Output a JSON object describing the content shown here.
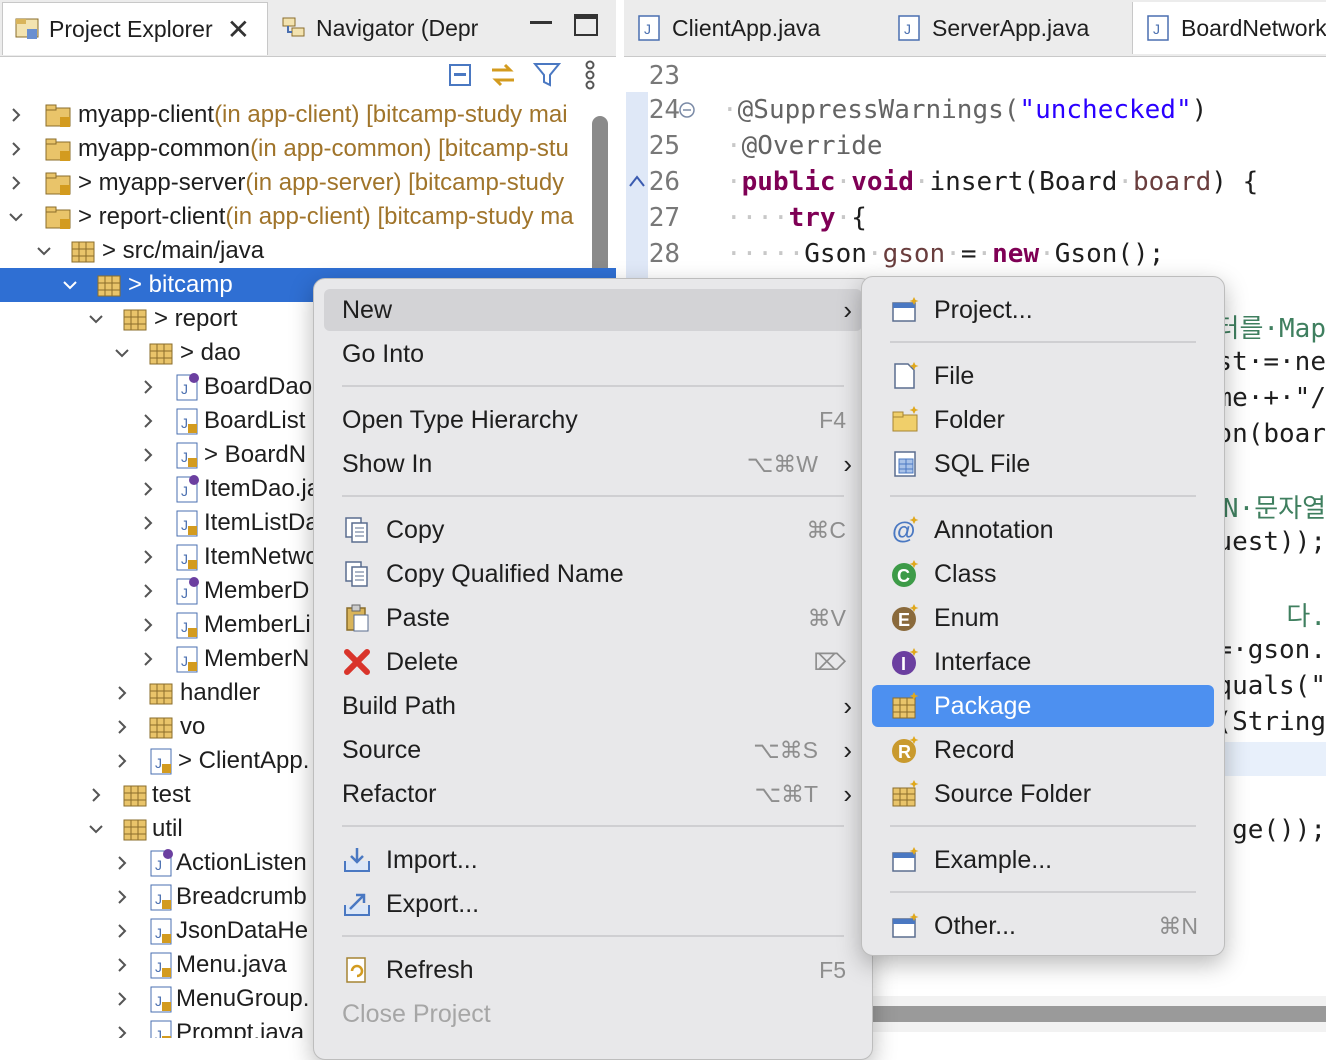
{
  "left_panel": {
    "tabs": [
      {
        "label": "Project Explorer",
        "icon": "project-explorer-icon",
        "active": true
      },
      {
        "label": "Navigator (Depr",
        "icon": "navigator-icon",
        "active": false
      }
    ],
    "toolbar_icons": [
      "collapse-all-icon",
      "link-with-editor-icon",
      "filter-icon",
      "view-menu-icon"
    ],
    "tree": [
      {
        "name": "myapp-client",
        "suffix": " (in app-client) [bitcamp-study mai"
      },
      {
        "name": "myapp-common",
        "suffix": " (in app-common) [bitcamp-stu"
      },
      {
        "name": "> myapp-server",
        "suffix": " (in app-server) [bitcamp-study"
      },
      {
        "name": "> report-client",
        "suffix": " (in app-client) [bitcamp-study ma"
      },
      {
        "name": "> src/main/java",
        "suffix": ""
      },
      {
        "name": "> bitcamp",
        "suffix": ""
      },
      {
        "name": "> report",
        "suffix": ""
      },
      {
        "name": "> dao",
        "suffix": ""
      },
      {
        "name": "BoardDao",
        "suffix": ""
      },
      {
        "name": "BoardList",
        "suffix": ""
      },
      {
        "name": "> BoardN",
        "suffix": ""
      },
      {
        "name": "ItemDao.ja",
        "suffix": ""
      },
      {
        "name": "ItemListDa",
        "suffix": ""
      },
      {
        "name": "ItemNetwo",
        "suffix": ""
      },
      {
        "name": "MemberD",
        "suffix": ""
      },
      {
        "name": "MemberLi",
        "suffix": ""
      },
      {
        "name": "MemberN",
        "suffix": ""
      },
      {
        "name": "handler",
        "suffix": ""
      },
      {
        "name": "vo",
        "suffix": ""
      },
      {
        "name": "> ClientApp.",
        "suffix": ""
      },
      {
        "name": "test",
        "suffix": ""
      },
      {
        "name": "util",
        "suffix": ""
      },
      {
        "name": "ActionListen",
        "suffix": ""
      },
      {
        "name": "Breadcrumb",
        "suffix": ""
      },
      {
        "name": "JsonDataHe",
        "suffix": ""
      },
      {
        "name": "Menu.java",
        "suffix": ""
      },
      {
        "name": "MenuGroup.",
        "suffix": ""
      },
      {
        "name": "Prompt.java",
        "suffix": ""
      }
    ]
  },
  "editor": {
    "tabs": [
      {
        "label": "ClientApp.java"
      },
      {
        "label": "ServerApp.java"
      },
      {
        "label": "BoardNetwork"
      }
    ],
    "line_numbers": [
      "23",
      "24",
      "25",
      "26",
      "27",
      "28"
    ],
    "code": {
      "l24_annotation": "@SuppressWarnings(",
      "l24_string": "\"unchecked\"",
      "l24_close": ")",
      "l25": "@Override",
      "l26_kw1": "public",
      "l26_kw2": "void",
      "l26_rest": "insert(Board",
      "l26_param": "board",
      "l26_end": ") {",
      "l27_kw": "try",
      "l27_end": "{",
      "l28_type": "Gson",
      "l28_var": "gson",
      "l28_eq": "=",
      "l28_kw": "new",
      "l28_end": "Gson();"
    },
    "right_fragments": [
      "터를·Map",
      "est·=·ne",
      "ame·+·\"/",
      "son(boar",
      "N·문자열",
      "uest));",
      "다.",
      "·=·gson.",
      "equals(\"",
      "(String",
      "ge());"
    ]
  },
  "context_menu": {
    "items": [
      {
        "label": "New",
        "submenu": true
      },
      {
        "label": "Go Into"
      },
      {
        "label": "Open Type Hierarchy",
        "shortcut": "F4"
      },
      {
        "label": "Show In",
        "shortcut": "⌥⌘W",
        "submenu": true
      },
      {
        "label": "Copy",
        "shortcut": "⌘C",
        "icon": "copy-icon"
      },
      {
        "label": "Copy Qualified Name",
        "icon": "copy-qualified-name-icon"
      },
      {
        "label": "Paste",
        "shortcut": "⌘V",
        "icon": "paste-icon"
      },
      {
        "label": "Delete",
        "shortcut": "⌦",
        "icon": "delete-icon"
      },
      {
        "label": "Build Path",
        "submenu": true
      },
      {
        "label": "Source",
        "shortcut": "⌥⌘S",
        "submenu": true
      },
      {
        "label": "Refactor",
        "shortcut": "⌥⌘T",
        "submenu": true
      },
      {
        "label": "Import...",
        "icon": "import-icon"
      },
      {
        "label": "Export...",
        "icon": "export-icon"
      },
      {
        "label": "Refresh",
        "shortcut": "F5",
        "icon": "refresh-icon"
      },
      {
        "label": "Close Project",
        "disabled": true
      }
    ]
  },
  "new_submenu": {
    "items": [
      {
        "label": "Project...",
        "icon": "new-project-icon"
      },
      {
        "label": "File",
        "icon": "new-file-icon"
      },
      {
        "label": "Folder",
        "icon": "new-folder-icon"
      },
      {
        "label": "SQL File",
        "icon": "sql-file-icon"
      },
      {
        "label": "Annotation",
        "icon": "annotation-icon"
      },
      {
        "label": "Class",
        "icon": "class-icon"
      },
      {
        "label": "Enum",
        "icon": "enum-icon"
      },
      {
        "label": "Interface",
        "icon": "interface-icon"
      },
      {
        "label": "Package",
        "icon": "package-icon",
        "selected": true
      },
      {
        "label": "Record",
        "icon": "record-icon"
      },
      {
        "label": "Source Folder",
        "icon": "source-folder-icon"
      },
      {
        "label": "Example...",
        "icon": "example-icon"
      },
      {
        "label": "Other...",
        "shortcut": "⌘N",
        "icon": "other-icon"
      }
    ]
  },
  "colors": {
    "selection_blue": "#2f6fd3",
    "menu_highlight": "#4d90f0",
    "keyword": "#7f0055",
    "string": "#2a00ff"
  }
}
